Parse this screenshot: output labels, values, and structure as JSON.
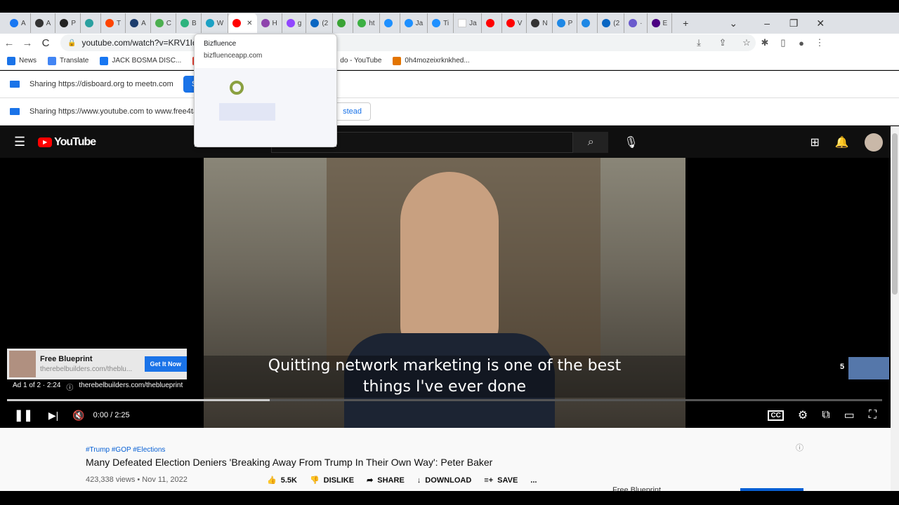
{
  "tabs": [
    {
      "label": "A",
      "color": "#1877f2"
    },
    {
      "label": "A",
      "color": "#333"
    },
    {
      "label": "P",
      "color": "#222"
    },
    {
      "label": "",
      "color": "#2aa0a0"
    },
    {
      "label": "T",
      "color": "#ff4500"
    },
    {
      "label": "A",
      "color": "#1c3d6e"
    },
    {
      "label": "C",
      "color": "#4caf50"
    },
    {
      "label": "B",
      "color": "#2db37e"
    },
    {
      "label": "W",
      "color": "#1da1c4"
    },
    {
      "label": "",
      "color": "#ff0000",
      "active": true
    },
    {
      "label": "H",
      "color": "#8e44ad"
    },
    {
      "label": "g",
      "color": "#9146ff"
    },
    {
      "label": "(2",
      "color": "#0a66c2"
    },
    {
      "label": "",
      "color": "#3aa335"
    },
    {
      "label": "ht",
      "color": "#3cb043"
    },
    {
      "label": "",
      "color": "#1e90ff"
    },
    {
      "label": "Ja",
      "color": "#1e90ff"
    },
    {
      "label": "Ti",
      "color": "#1e90ff"
    },
    {
      "label": "Ja",
      "color": "#fff"
    },
    {
      "label": "",
      "color": "#ff0000"
    },
    {
      "label": "V",
      "color": "#ff0000"
    },
    {
      "label": "N",
      "color": "#333"
    },
    {
      "label": "P",
      "color": "#1e88e5"
    },
    {
      "label": "",
      "color": "#1e88e5"
    },
    {
      "label": "(2",
      "color": "#0a66c2"
    },
    {
      "label": "·",
      "color": "#6a5acd"
    },
    {
      "label": "E",
      "color": "#4b0082"
    }
  ],
  "window": {
    "new_tab": "+",
    "dropdown": "⌄",
    "minimize": "–",
    "restore": "❐",
    "close": "✕"
  },
  "toolbar": {
    "url": "youtube.com/watch?v=KRV1IdN",
    "back": "←",
    "forward": "→",
    "reload": "C"
  },
  "bookmarks": [
    {
      "label": "News",
      "color": "#1a73e8"
    },
    {
      "label": "Translate",
      "color": "#4285f4"
    },
    {
      "label": "JACK BOSMA DISC...",
      "color": "#1877f2"
    },
    {
      "label": "",
      "color": "#ea4335"
    },
    {
      "label": "do - YouTube",
      "color": "#ff0000"
    },
    {
      "label": "0h4mozeixrknkhed...",
      "color": "#e37400"
    }
  ],
  "sharing": [
    {
      "text": "Sharing https://disboard.org to meetn.com",
      "button": "Sto"
    },
    {
      "text": "Sharing https://www.youtube.com to www.free4tall",
      "button": "stead"
    }
  ],
  "tooltip": {
    "title": "Bizfluence",
    "url": "bizfluenceapp.com"
  },
  "youtube": {
    "logo": "YouTube"
  },
  "player": {
    "caption_line1": "Quitting network marketing is one of the best",
    "caption_line2": "things I've ever done",
    "time": "0:00 / 2:25",
    "progress": 0.0,
    "ad_progress": 0.3,
    "skip_count": "5",
    "ad": {
      "title": "Free Blueprint",
      "url": "therebelbuilders.com/theblu...",
      "cta": "Get It Now",
      "info": "Ad 1 of 2 · 2:24",
      "link": "therebelbuilders.com/theblueprint"
    }
  },
  "video": {
    "hashtags": "#Trump #GOP #Elections",
    "title": "Many Defeated Election Deniers 'Breaking Away From Trump In Their Own Way': Peter Baker",
    "meta": "423,338 views • Nov 11, 2022",
    "likes": "5.5K",
    "dislike": "DISLIKE",
    "share": "SHARE",
    "download": "DOWNLOAD",
    "save": "SAVE",
    "more": "...",
    "side_ad": "Free Blueprint"
  }
}
